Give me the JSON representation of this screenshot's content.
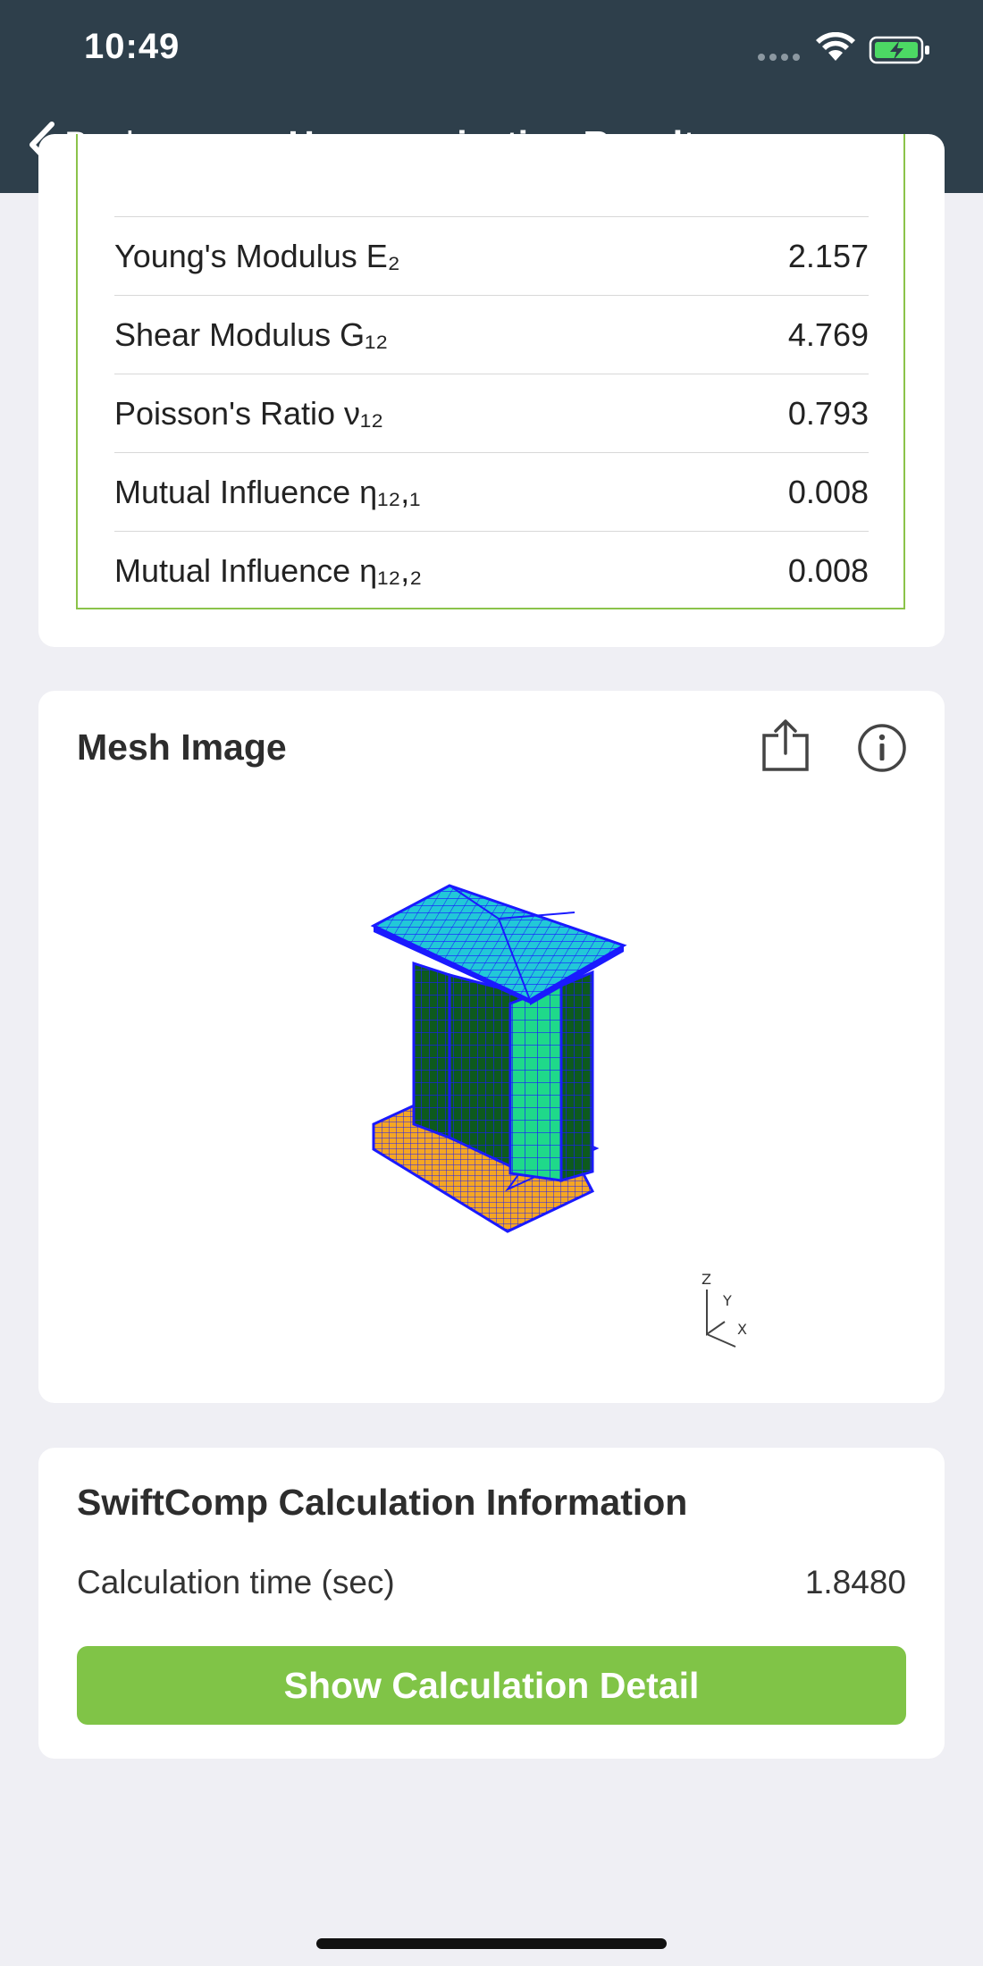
{
  "status_bar": {
    "time": "10:49"
  },
  "nav": {
    "back_label": "Back",
    "title": "Homogenization Result"
  },
  "properties": [
    {
      "label": "Young's Modulus E₂",
      "value": "2.157"
    },
    {
      "label": "Shear Modulus G₁₂",
      "value": "4.769"
    },
    {
      "label": "Poisson's Ratio ν₁₂",
      "value": "0.793"
    },
    {
      "label": "Mutual Influence η₁₂,₁",
      "value": "0.008"
    },
    {
      "label": "Mutual Influence η₁₂,₂",
      "value": "0.008"
    }
  ],
  "mesh": {
    "title": "Mesh Image",
    "axes": {
      "z": "Z",
      "y": "Y",
      "x": "X"
    }
  },
  "calc_info": {
    "title": "SwiftComp Calculation Information",
    "time_label": "Calculation time (sec)",
    "time_value": "1.8480",
    "button_label": "Show Calculation Detail"
  },
  "colors": {
    "accent": "#80c447",
    "navbar": "#2e3f4b",
    "mesh_green": "#1fd98a",
    "mesh_dark": "#0d5a1e",
    "mesh_top": "#22c8d8",
    "mesh_orange": "#f5a623",
    "mesh_edge": "#1a1aff"
  }
}
